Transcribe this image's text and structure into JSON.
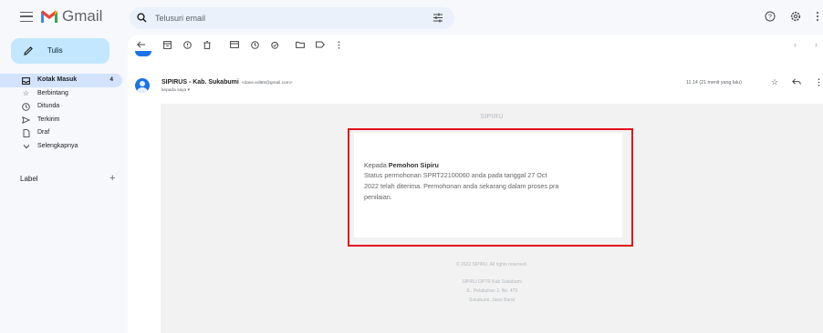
{
  "app": {
    "name": "Gmail"
  },
  "search": {
    "placeholder": "Telusuri email"
  },
  "compose": {
    "label": "Tulis"
  },
  "sidebar": {
    "items": [
      {
        "label": "Kotak Masuk",
        "count": "4",
        "icon": "inbox-icon"
      },
      {
        "label": "Berbintang",
        "icon": "star-icon"
      },
      {
        "label": "Ditunda",
        "icon": "clock-icon"
      },
      {
        "label": "Terkirim",
        "icon": "send-icon"
      },
      {
        "label": "Draf",
        "icon": "draft-icon"
      },
      {
        "label": "Selengkapnya",
        "icon": "chevron-down-icon"
      }
    ],
    "labels_title": "Label"
  },
  "message": {
    "sender_name": "SIPIRUS - Kab. Sukabumi",
    "sender_email": "<dave.edi65@gmail.com>",
    "to_line": "kepada saya",
    "time": "11.14 (21 menit yang lalu)"
  },
  "email": {
    "brand": "SIPIRU",
    "greeting_prefix": "Kepada ",
    "greeting_name": "Pemohon Sipiru",
    "body_lines": [
      "Status permohonan SPRT22100060 anda pada tanggal 27 Oct",
      "2022 telah diterima. Permohonan anda sekarang dalam proses pra",
      "penilaian."
    ],
    "footer_lines": [
      "© 2022 SIPIRU. All rights reserved.",
      "SIPIRU DPTR Kab Sukabumi",
      "JL. Pelabuhan 2, No. 479",
      "Sukabumi, Jawa Barat"
    ]
  },
  "colors": {
    "highlight": "#e3101c",
    "compose_bg": "#c2e7ff",
    "active_bg": "#d3e3fd"
  }
}
